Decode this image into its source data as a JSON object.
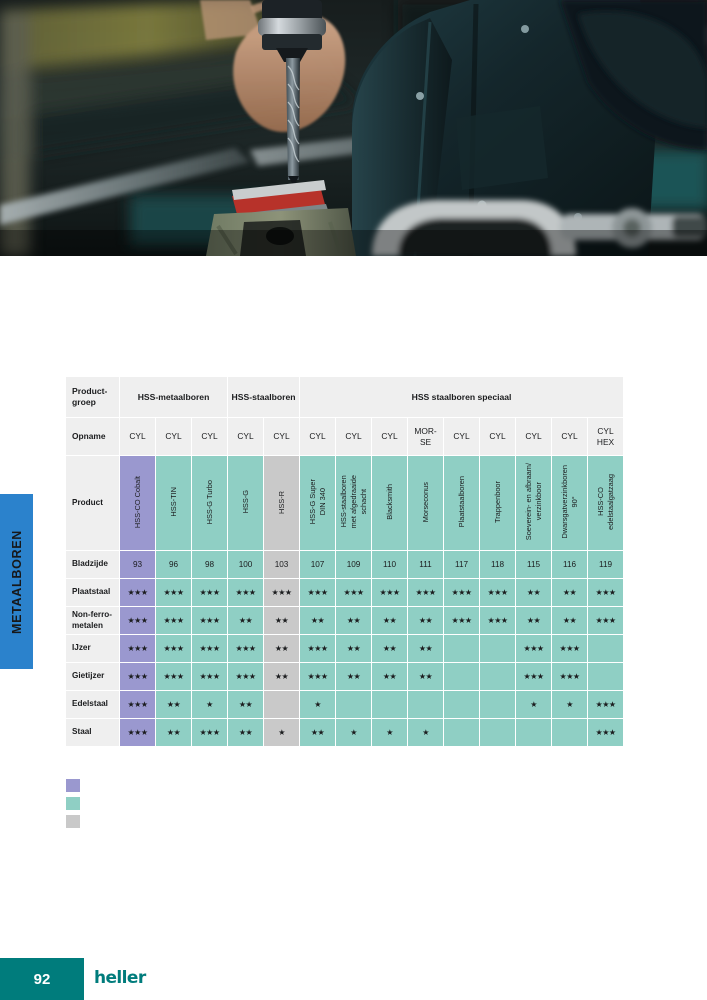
{
  "page": {
    "side_tab_label": "METAALBOREN",
    "page_number": "92",
    "brand": "heller"
  },
  "hero": {
    "alt": "worker-drilling-metal-photo"
  },
  "table": {
    "row_header_labels": {
      "productgroep": "Product-\ngroep",
      "opname": "Opname",
      "product": "Product"
    },
    "groups": [
      {
        "label": "",
        "span": 1
      },
      {
        "label": "HSS-metaalboren",
        "span": 3
      },
      {
        "label": "HSS-staalboren",
        "span": 2
      },
      {
        "label": "HSS staalboren speciaal",
        "span": 9
      }
    ],
    "opname": [
      "CYL",
      "CYL",
      "CYL",
      "CYL",
      "CYL",
      "CYL",
      "CYL",
      "CYL",
      "MOR-\nSE",
      "CYL",
      "CYL",
      "CYL",
      "CYL",
      "CYL\nHEX"
    ],
    "products": [
      "HSS-CO Cobalt",
      "HSS-TIN",
      "HSS-G Turbo",
      "HSS-G",
      "HSS-R",
      "HSS-G Super\nDIN 340",
      "HSS-staalboren\nmet afgedraaide\nschacht",
      "Blacksmith",
      "Morseconus",
      "Plaatstaalboren",
      "Trappenboor",
      "Soeverein- en afbraam/\nverzinkboor",
      "Dwarsgatverzinkboren\n90°",
      "HSS-CO\nedelstaalgatzaag"
    ],
    "column_colors": [
      "purple",
      "teal",
      "teal",
      "teal",
      "gray",
      "teal",
      "teal",
      "teal",
      "teal",
      "teal",
      "teal",
      "teal",
      "teal",
      "teal"
    ],
    "rows": [
      {
        "label": "Bladzijde",
        "values": [
          "93",
          "96",
          "98",
          "100",
          "103",
          "107",
          "109",
          "110",
          "111",
          "117",
          "118",
          "115",
          "116",
          "119"
        ]
      },
      {
        "label": "Plaatstaal",
        "values": [
          "★★★",
          "★★★",
          "★★★",
          "★★★",
          "★★★",
          "★★★",
          "★★★",
          "★★★",
          "★★★",
          "★★★",
          "★★★",
          "★★",
          "★★",
          "★★★"
        ]
      },
      {
        "label": "Non-ferro-\nmetalen",
        "values": [
          "★★★",
          "★★★",
          "★★★",
          "★★",
          "★★",
          "★★",
          "★★",
          "★★",
          "★★",
          "★★★",
          "★★★",
          "★★",
          "★★",
          "★★★"
        ]
      },
      {
        "label": "IJzer",
        "values": [
          "★★★",
          "★★★",
          "★★★",
          "★★★",
          "★★",
          "★★★",
          "★★",
          "★★",
          "★★",
          "",
          "",
          "★★★",
          "★★★",
          ""
        ]
      },
      {
        "label": "Gietijzer",
        "values": [
          "★★★",
          "★★★",
          "★★★",
          "★★★",
          "★★",
          "★★★",
          "★★",
          "★★",
          "★★",
          "",
          "",
          "★★★",
          "★★★",
          ""
        ]
      },
      {
        "label": "Edelstaal",
        "values": [
          "★★★",
          "★★",
          "★",
          "★★",
          "",
          "★",
          "",
          "",
          "",
          "",
          "",
          "★",
          "★",
          "★★★"
        ]
      },
      {
        "label": "Staal",
        "values": [
          "★★★",
          "★★",
          "★★★",
          "★★",
          "★",
          "★★",
          "★",
          "★",
          "★",
          "",
          "",
          "",
          "",
          "★★★"
        ]
      }
    ]
  },
  "legend": {
    "swatches": [
      "#9a98cf",
      "#8fcfc4",
      "#c9c9c9"
    ]
  },
  "colors": {
    "teal": "#8fcfc4",
    "purple": "#9a98cf",
    "gray": "#c9c9c9",
    "header_gray": "#efefef",
    "tab_blue": "#2b82cc",
    "brand_teal": "#007c7c"
  }
}
